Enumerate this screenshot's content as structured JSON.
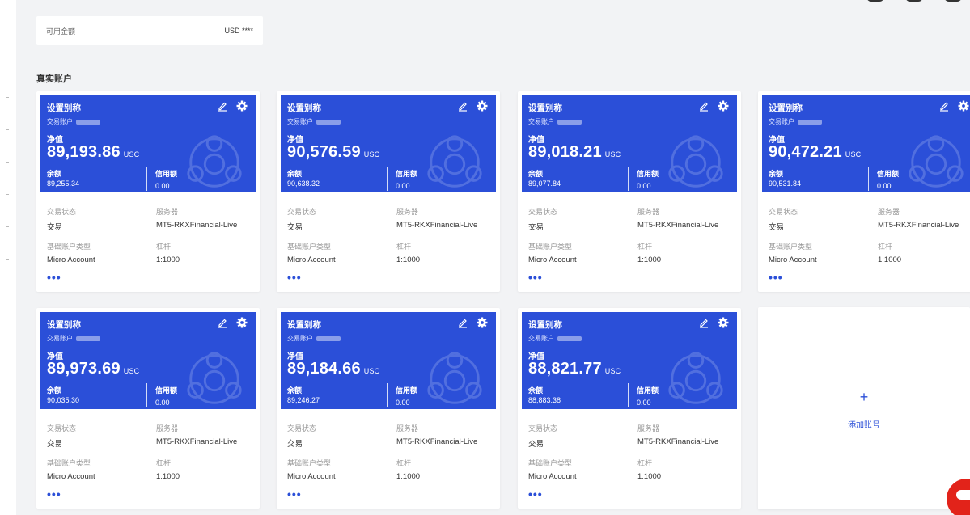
{
  "summary": {
    "available_label": "可用金额",
    "available_value": "USD ****"
  },
  "section_title": "真实账户",
  "accounts": [
    {
      "alias": "设置别称",
      "account_label": "交易账户",
      "equity_label": "净值",
      "equity": "89,193.86",
      "currency": "USC",
      "balance_label": "余额",
      "balance": "89,255.34",
      "credit_label": "信用额",
      "credit": "0.00",
      "status_label": "交易状态",
      "status": "交易",
      "server_label": "服务器",
      "server": "MT5-RKXFinancial-Live",
      "type_label": "基础账户类型",
      "type": "Micro Account",
      "leverage_label": "杠杆",
      "leverage": "1:1000",
      "more": "•••"
    },
    {
      "alias": "设置别称",
      "account_label": "交易账户",
      "equity_label": "净值",
      "equity": "90,576.59",
      "currency": "USC",
      "balance_label": "余额",
      "balance": "90,638.32",
      "credit_label": "信用额",
      "credit": "0.00",
      "status_label": "交易状态",
      "status": "交易",
      "server_label": "服务器",
      "server": "MT5-RKXFinancial-Live",
      "type_label": "基础账户类型",
      "type": "Micro Account",
      "leverage_label": "杠杆",
      "leverage": "1:1000",
      "more": "•••"
    },
    {
      "alias": "设置别称",
      "account_label": "交易账户",
      "equity_label": "净值",
      "equity": "89,018.21",
      "currency": "USC",
      "balance_label": "余额",
      "balance": "89,077.84",
      "credit_label": "信用额",
      "credit": "0.00",
      "status_label": "交易状态",
      "status": "交易",
      "server_label": "服务器",
      "server": "MT5-RKXFinancial-Live",
      "type_label": "基础账户类型",
      "type": "Micro Account",
      "leverage_label": "杠杆",
      "leverage": "1:1000",
      "more": "•••"
    },
    {
      "alias": "设置别称",
      "account_label": "交易账户",
      "equity_label": "净值",
      "equity": "90,472.21",
      "currency": "USC",
      "balance_label": "余额",
      "balance": "90,531.84",
      "credit_label": "信用额",
      "credit": "0.00",
      "status_label": "交易状态",
      "status": "交易",
      "server_label": "服务器",
      "server": "MT5-RKXFinancial-Live",
      "type_label": "基础账户类型",
      "type": "Micro Account",
      "leverage_label": "杠杆",
      "leverage": "1:1000",
      "more": "•••"
    },
    {
      "alias": "设置别称",
      "account_label": "交易账户",
      "equity_label": "净值",
      "equity": "89,973.69",
      "currency": "USC",
      "balance_label": "余额",
      "balance": "90,035.30",
      "credit_label": "信用额",
      "credit": "0.00",
      "status_label": "交易状态",
      "status": "交易",
      "server_label": "服务器",
      "server": "MT5-RKXFinancial-Live",
      "type_label": "基础账户类型",
      "type": "Micro Account",
      "leverage_label": "杠杆",
      "leverage": "1:1000",
      "more": "•••"
    },
    {
      "alias": "设置别称",
      "account_label": "交易账户",
      "equity_label": "净值",
      "equity": "89,184.66",
      "currency": "USC",
      "balance_label": "余额",
      "balance": "89,246.27",
      "credit_label": "信用额",
      "credit": "0.00",
      "status_label": "交易状态",
      "status": "交易",
      "server_label": "服务器",
      "server": "MT5-RKXFinancial-Live",
      "type_label": "基础账户类型",
      "type": "Micro Account",
      "leverage_label": "杠杆",
      "leverage": "1:1000",
      "more": "•••"
    },
    {
      "alias": "设置别称",
      "account_label": "交易账户",
      "equity_label": "净值",
      "equity": "88,821.77",
      "currency": "USC",
      "balance_label": "余额",
      "balance": "88,883.38",
      "credit_label": "信用额",
      "credit": "0.00",
      "status_label": "交易状态",
      "status": "交易",
      "server_label": "服务器",
      "server": "MT5-RKXFinancial-Live",
      "type_label": "基础账户类型",
      "type": "Micro Account",
      "leverage_label": "杠杆",
      "leverage": "1:1000",
      "more": "•••"
    }
  ],
  "add_account": {
    "plus": "+",
    "label": "添加账号"
  },
  "colors": {
    "card_header": "#2b4fd8",
    "accent": "#2b4fd8",
    "chat_button": "#e2231a"
  },
  "icons": {
    "edit": "edit-icon",
    "settings": "gear-icon",
    "chat": "chat-icon"
  }
}
